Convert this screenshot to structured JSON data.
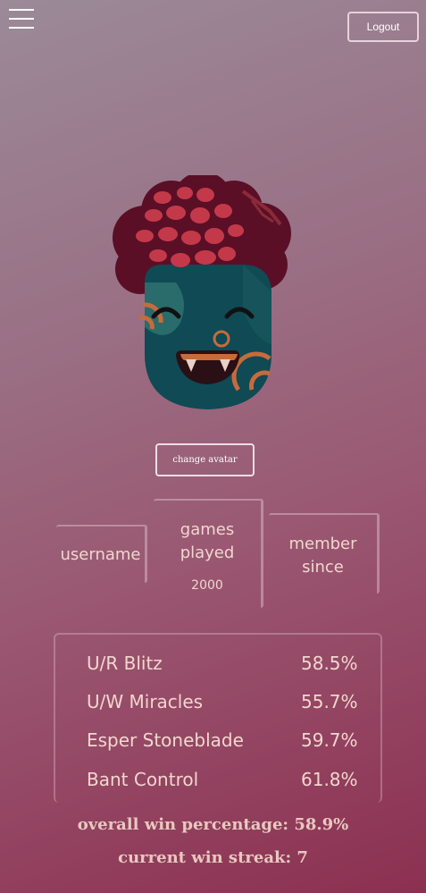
{
  "header": {
    "menu_icon": "hamburger-menu-icon",
    "logout_label": "Logout"
  },
  "avatar": {
    "icon": "smiling-face-avatar-with-red-curly-hair",
    "change_label": "change avatar"
  },
  "stats": {
    "username_label": "username",
    "games_label_line1": "games",
    "games_label_line2": "played",
    "games_value": "2000",
    "member_label_line1": "member",
    "member_label_line2": "since"
  },
  "decks": [
    {
      "name": "U/R Blitz",
      "pct": "58.5%"
    },
    {
      "name": "U/W Miracles",
      "pct": "55.7%"
    },
    {
      "name": "Esper Stoneblade",
      "pct": "59.7%"
    },
    {
      "name": "Bant Control",
      "pct": "61.8%"
    }
  ],
  "summary": {
    "overall": "overall win percentage: 58.9%",
    "streak": "current win streak: 7"
  },
  "colors": {
    "hair": "#5a0f26",
    "hair_spots": "#c4394a",
    "face": "#0f4a55",
    "face_patch": "#2a6b6b",
    "accent_orange": "#c66b3c",
    "mouth": "#2a0f14"
  }
}
